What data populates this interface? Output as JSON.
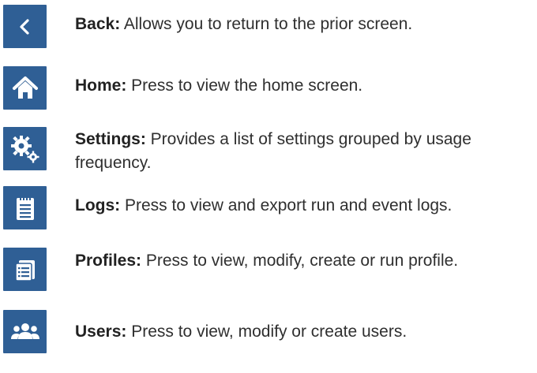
{
  "items": [
    {
      "icon": "back-chevron-icon",
      "term": "Back:",
      "text": " Allows you to return to the prior screen."
    },
    {
      "icon": "home-icon",
      "term": "Home:",
      "text": " Press to view the home screen."
    },
    {
      "icon": "gears-icon",
      "term": "Settings:",
      "text": " Provides a list of settings grouped by usage frequency."
    },
    {
      "icon": "clipboard-log-icon",
      "term": "Logs:",
      "text": " Press to view and export run and event logs."
    },
    {
      "icon": "profiles-list-icon",
      "term": "Profiles:",
      "text": " Press to view, modify, create or run profile."
    },
    {
      "icon": "users-group-icon",
      "term": "Users:",
      "text": " Press to view, modify or create users."
    }
  ],
  "colors": {
    "tile": "#2f5f95",
    "icon": "#ffffff",
    "text": "#2f2f2f"
  }
}
